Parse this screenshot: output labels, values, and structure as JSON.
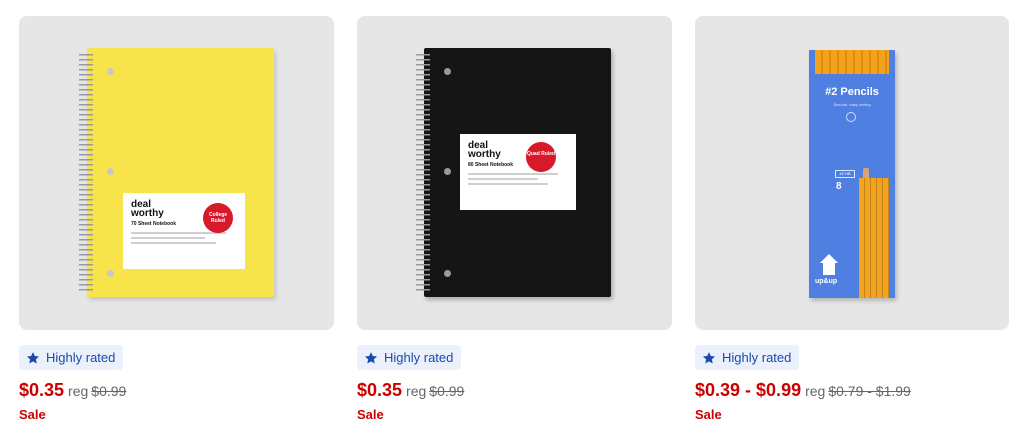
{
  "products": [
    {
      "badge": "Highly rated",
      "price": "$0.35",
      "reg_label": "reg",
      "reg_price": "$0.99",
      "sale_label": "Sale",
      "image": {
        "brand_line1": "deal",
        "brand_line2": "worthy",
        "product_line": "70 Sheet Notebook",
        "dot_text": "College Ruled",
        "cover_color": "#f6e44a"
      }
    },
    {
      "badge": "Highly rated",
      "price": "$0.35",
      "reg_label": "reg",
      "reg_price": "$0.99",
      "sale_label": "Sale",
      "image": {
        "brand_line1": "deal",
        "brand_line2": "worthy",
        "product_line": "80 Sheet Notebook",
        "dot_text": "Quad Ruled",
        "cover_color": "#151515"
      }
    },
    {
      "badge": "Highly rated",
      "price": "$0.39 - $0.99",
      "reg_label": "reg",
      "reg_price": "$0.79 - $1.99",
      "sale_label": "Sale",
      "image": {
        "title": "#2 Pencils",
        "subtitle": "Smooth, easy writing",
        "tag": "#2 HB",
        "count": "8",
        "brand": "up&up",
        "cover_color": "#4f7fe0"
      }
    }
  ],
  "colors": {
    "sale_red": "#cc0000",
    "badge_bg": "#ebf1fc",
    "badge_text": "#1b4aa8",
    "card_bg": "#e6e6e6"
  },
  "icons": {
    "badge_icon": "star-icon"
  }
}
